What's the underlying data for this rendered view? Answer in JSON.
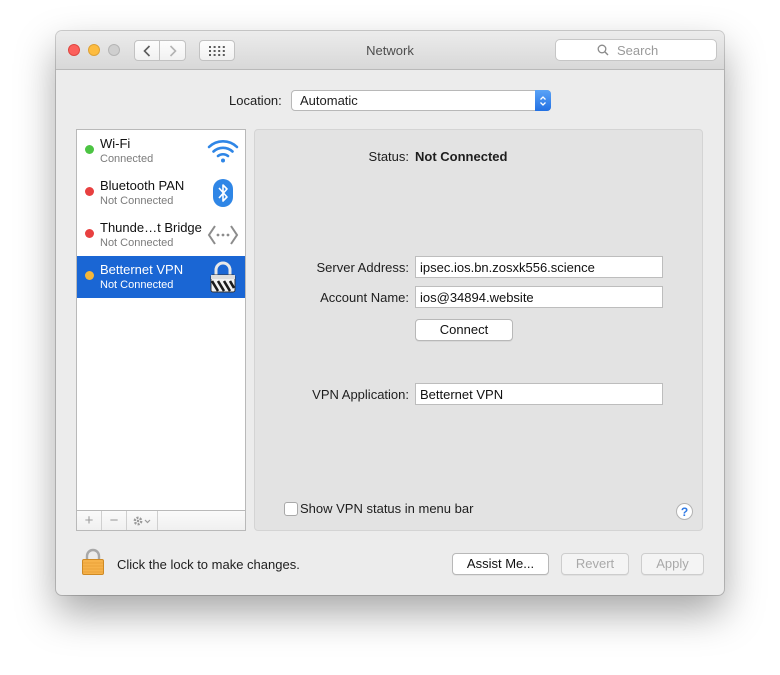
{
  "window": {
    "title": "Network"
  },
  "search": {
    "placeholder": "Search"
  },
  "location": {
    "label": "Location:",
    "value": "Automatic"
  },
  "services": [
    {
      "name": "Wi-Fi",
      "status": "Connected",
      "status_color": "#4cc443",
      "icon": "wifi-icon"
    },
    {
      "name": "Bluetooth PAN",
      "status": "Not Connected",
      "status_color": "#e84040",
      "icon": "bluetooth-icon"
    },
    {
      "name": "Thunde…t Bridge",
      "status": "Not Connected",
      "status_color": "#e84040",
      "icon": "thunderbolt-bridge-icon"
    },
    {
      "name": "Betternet VPN",
      "status": "Not Connected",
      "status_color": "#f5b638",
      "icon": "vpn-lock-icon",
      "selected": true
    }
  ],
  "sidebar_footer": {
    "add": "+",
    "remove": "−"
  },
  "detail": {
    "status_label": "Status:",
    "status_value": "Not Connected",
    "server_label": "Server Address:",
    "server_value": "ipsec.ios.bn.zosxk556.science",
    "account_label": "Account Name:",
    "account_value": "ios@34894.website",
    "connect_label": "Connect",
    "vpn_app_label": "VPN Application:",
    "vpn_app_value": "Betternet VPN",
    "menu_bar_checkbox_label": "Show VPN status in menu bar",
    "help": "?"
  },
  "footer": {
    "lock_text": "Click the lock to make changes.",
    "assist_label": "Assist Me...",
    "revert_label": "Revert",
    "apply_label": "Apply"
  },
  "colors": {
    "accent": "#1a66d4",
    "window_bg": "#ececec"
  }
}
